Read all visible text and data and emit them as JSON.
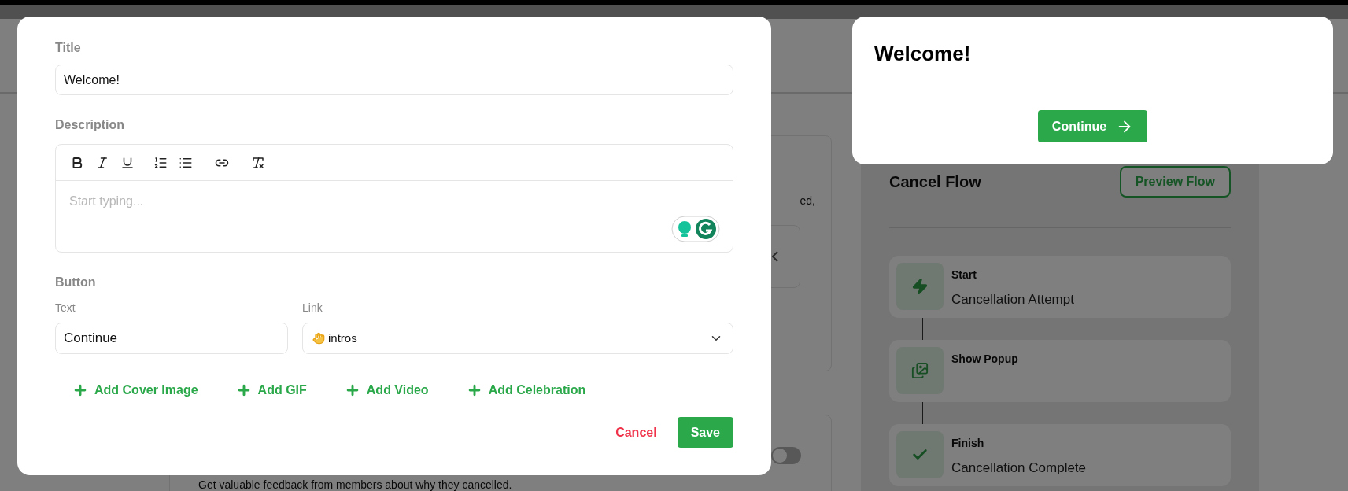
{
  "editor_modal": {
    "title_label": "Title",
    "title_value": "Welcome!",
    "description_label": "Description",
    "description_placeholder": "Start typing...",
    "button_section_label": "Button",
    "text_label": "Text",
    "text_value": "Continue",
    "link_label": "Link",
    "link_value": "intros",
    "add_actions": [
      "Add Cover Image",
      "Add GIF",
      "Add Video",
      "Add Celebration"
    ],
    "cancel": "Cancel",
    "save": "Save"
  },
  "preview_popup": {
    "title": "Welcome!",
    "button": "Continue"
  },
  "background": {
    "card_text_fragment": "ed,",
    "toggle": {
      "on": false
    },
    "feedback_text": "Get valuable feedback from members about why they cancelled.",
    "cancel_flow": {
      "title": "Cancel Flow",
      "preview_button": "Preview Flow",
      "steps": [
        {
          "kind": "trigger",
          "label": "Start",
          "detail": "Cancellation Attempt"
        },
        {
          "kind": "popup",
          "label": "Show Popup"
        },
        {
          "kind": "finish",
          "label": "Finish",
          "detail": "Cancellation Complete"
        }
      ]
    }
  }
}
